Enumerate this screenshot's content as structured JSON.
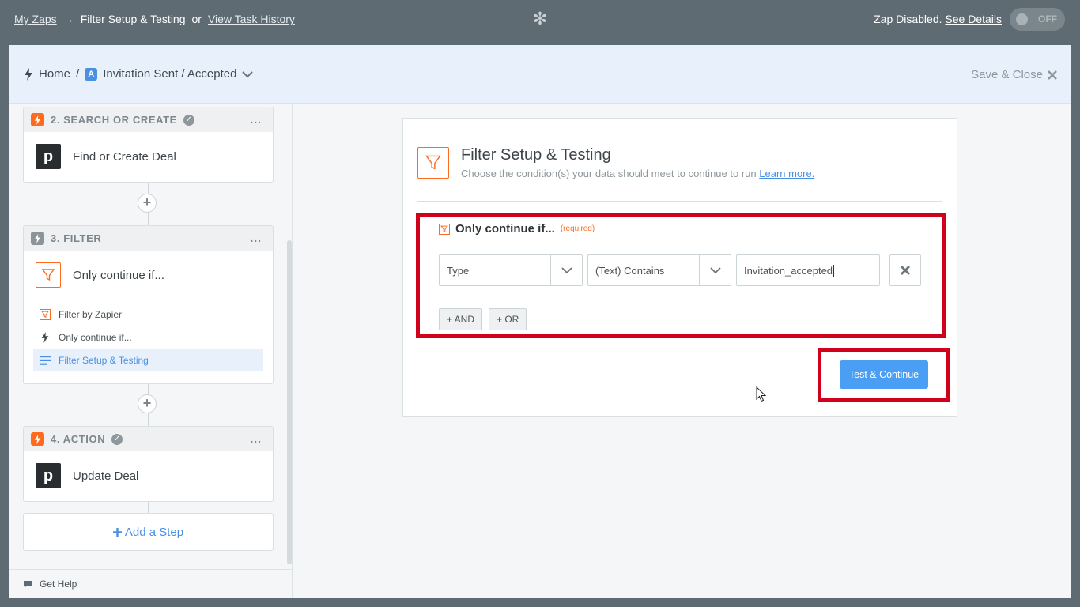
{
  "topbar": {
    "my_zaps": "My Zaps",
    "arrow": "→",
    "current": "Filter Setup & Testing",
    "or": "or",
    "task_history": "View Task History",
    "status": "Zap Disabled.",
    "see_details": "See Details",
    "toggle_label": "OFF"
  },
  "subheader": {
    "home": "Home",
    "separator": "/",
    "app_badge": "A",
    "zap_name": "Invitation Sent / Accepted",
    "save_close": "Save & Close"
  },
  "sidebar": {
    "step2": {
      "label": "2. SEARCH OR CREATE",
      "app_letter": "p",
      "title": "Find or Create Deal"
    },
    "step3": {
      "label": "3. FILTER",
      "title": "Only continue if...",
      "items": [
        {
          "label": "Filter by Zapier"
        },
        {
          "label": "Only continue if..."
        },
        {
          "label": "Filter Setup & Testing"
        }
      ]
    },
    "step4": {
      "label": "4. ACTION",
      "app_letter": "p",
      "title": "Update Deal"
    },
    "more": "...",
    "plus": "+",
    "add_step": "Add a Step",
    "get_help": "Get Help"
  },
  "main": {
    "title": "Filter Setup & Testing",
    "subtitle": "Choose the condition(s) your data should meet to continue to run",
    "learn_more": "Learn more.",
    "filter_label": "Only continue if...",
    "required": "(required)",
    "field": "Type",
    "operator": "(Text) Contains",
    "value": "Invitation_accepted",
    "and_button": "+ AND",
    "or_button": "+ OR",
    "test_button": "Test & Continue"
  },
  "colors": {
    "accent": "#4a90e2",
    "zapier_orange": "#ff6a1e",
    "highlight_red": "#d0021b",
    "topbar": "#5f6b72"
  }
}
